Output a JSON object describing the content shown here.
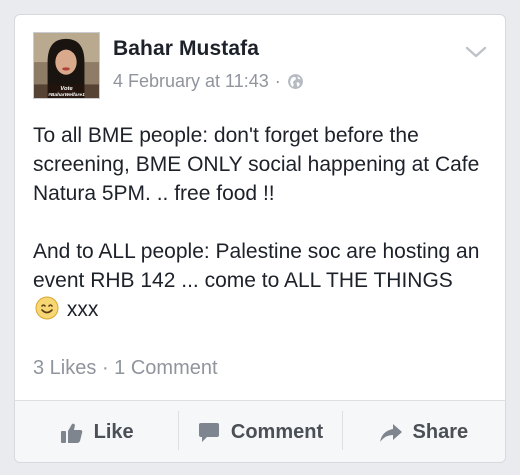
{
  "post": {
    "author": "Bahar Mustafa",
    "timestamp": "4 February at 11:43",
    "meta_separator": "·",
    "privacy_icon": "globe-icon",
    "avatar_caption": "Vote #BaharWelfare1",
    "menu_icon": "chevron-down-icon",
    "paragraph1": "To all BME people: don't forget before the screening, BME ONLY social happening at Cafe Natura 5PM. .. free food !!",
    "paragraph2_before": "And to ALL people: Palestine soc are hosting an event RHB 142 ... come to ALL THE THINGS",
    "paragraph2_emoji": "smiley-icon",
    "paragraph2_after": "xxx"
  },
  "stats": {
    "likes": "3 Likes",
    "separator": "·",
    "comments": "1 Comment"
  },
  "actions": {
    "like_label": "Like",
    "comment_label": "Comment",
    "share_label": "Share"
  },
  "colors": {
    "text": "#1d2129",
    "secondary": "#90949c",
    "action": "#4b4f56",
    "background": "#e9ebee"
  }
}
